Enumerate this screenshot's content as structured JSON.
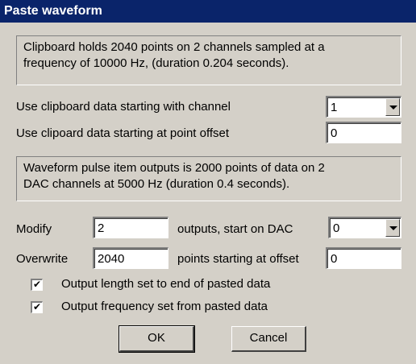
{
  "dialog": {
    "title": "Paste waveform"
  },
  "clipboard_info": {
    "line1": "Clipboard holds 2040 points on 2 channels sampled at a",
    "line2": "frequency of 10000 Hz, (duration 0.204 seconds)."
  },
  "start_channel": {
    "label": "Use clipboard data starting with channel",
    "value": "1"
  },
  "point_offset": {
    "label": "Use clipoard data starting at point offset",
    "value": "0"
  },
  "waveform_info": {
    "line1": "Waveform pulse item outputs is 2000 points of data on 2",
    "line2": "DAC channels at 5000 Hz (duration 0.4 seconds)."
  },
  "modify": {
    "label": "Modify",
    "value": "2",
    "suffix_label": "outputs, start on DAC",
    "dac_value": "0"
  },
  "overwrite": {
    "label": "Overwrite",
    "value": "2040",
    "suffix_label": "points starting at offset",
    "offset_value": "0"
  },
  "options": [
    {
      "label": "Output length set to end of pasted data",
      "checked": true,
      "mark": "✔"
    },
    {
      "label": "Output frequency set from pasted data",
      "checked": true,
      "mark": "✔"
    }
  ],
  "buttons": {
    "ok": "OK",
    "cancel": "Cancel"
  }
}
